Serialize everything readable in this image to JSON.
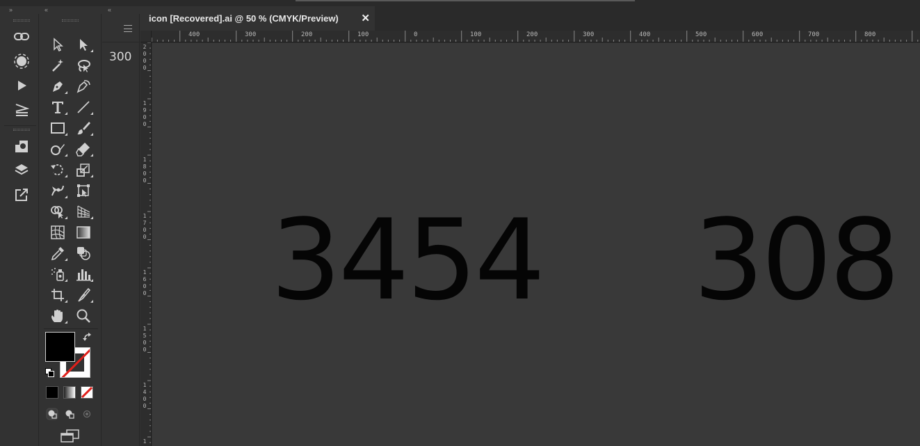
{
  "document_tab": {
    "title": "icon [Recovered].ai @ 50 % (CMYK/Preview)",
    "close_symbol": "✕"
  },
  "properties_panel": {
    "value": "300"
  },
  "chevrons": {
    "expand": "»",
    "collapse": "«"
  },
  "ruler": {
    "horizontal_labels": [
      "400",
      "300",
      "200",
      "100",
      "0",
      "100",
      "200",
      "300",
      "400",
      "500",
      "600",
      "700",
      "800"
    ],
    "vertical_labels": [
      "2000",
      "1900",
      "1800",
      "1700",
      "1600",
      "1500",
      "1400",
      "1"
    ]
  },
  "canvas": {
    "text_left": "3454",
    "text_right": "308"
  },
  "colors": {
    "fill": "#000000",
    "stroke": "none",
    "accent_red": "#e0201b"
  },
  "dock_icons": [
    "links-icon",
    "recolor-icon",
    "play-action-icon",
    "paragraph-align-icon",
    "asset-export-icon",
    "layers-icon",
    "export-icon"
  ],
  "tool_icons": [
    "selection-tool-icon",
    "direct-selection-tool-icon",
    "magic-wand-tool-icon",
    "lasso-tool-icon",
    "pen-tool-icon",
    "curvature-tool-icon",
    "type-tool-icon",
    "line-segment-tool-icon",
    "rectangle-tool-icon",
    "paintbrush-tool-icon",
    "shaper-tool-icon",
    "eraser-tool-icon",
    "rotate-tool-icon",
    "scale-tool-icon",
    "puppet-warp-tool-icon",
    "free-transform-tool-icon",
    "shape-builder-tool-icon",
    "perspective-grid-tool-icon",
    "mesh-tool-icon",
    "gradient-tool-icon",
    "eyedropper-tool-icon",
    "blend-tool-icon",
    "symbol-sprayer-tool-icon",
    "column-graph-tool-icon",
    "artboard-tool-icon",
    "slice-tool-icon",
    "hand-tool-icon",
    "zoom-tool-icon"
  ]
}
